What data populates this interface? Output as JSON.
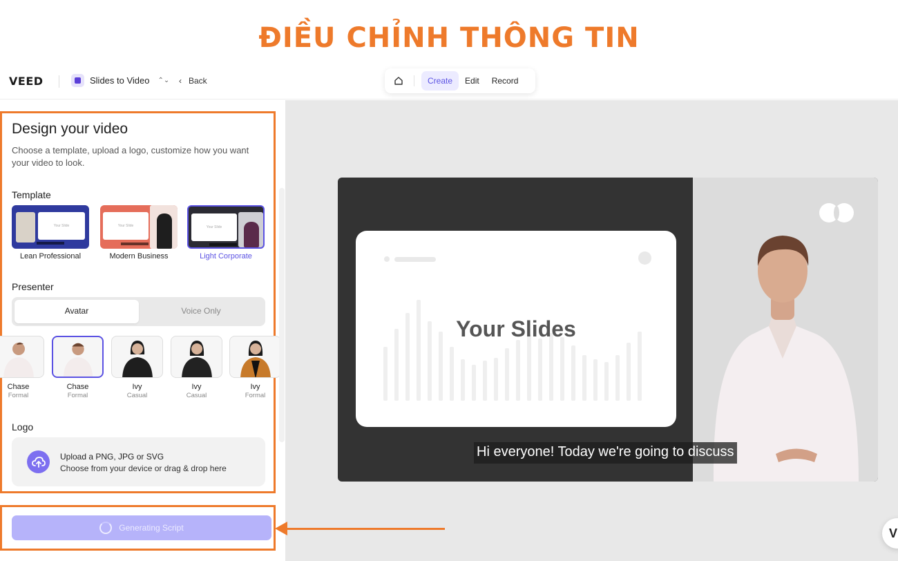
{
  "banner": {
    "title": "ĐIỀU CHỈNH THÔNG TIN"
  },
  "header": {
    "logo": "VEED",
    "project_name": "Slides to Video",
    "back_label": "Back",
    "modes": [
      "Create",
      "Edit",
      "Record"
    ],
    "active_mode": "Create"
  },
  "panel": {
    "title": "Design your video",
    "description": "Choose a template, upload a logo, customize how you want your video to look.",
    "template_label": "Template",
    "templates": [
      {
        "name": "Lean Professional",
        "slide_text": "Your Slide",
        "color": "#2f3a9e"
      },
      {
        "name": "Modern Business",
        "slide_text": "Your Slide",
        "color": "#e56d5a"
      },
      {
        "name": "Light Corporate",
        "slide_text": "Your Slide",
        "color": "#2b2b33",
        "selected": true
      }
    ],
    "presenter_label": "Presenter",
    "presenter_modes": [
      "Avatar",
      "Voice Only"
    ],
    "presenters": [
      {
        "name": "Chase",
        "style": "Formal"
      },
      {
        "name": "Chase",
        "style": "Formal",
        "selected": true
      },
      {
        "name": "Ivy",
        "style": "Casual"
      },
      {
        "name": "Ivy",
        "style": "Casual"
      },
      {
        "name": "Ivy",
        "style": "Formal"
      }
    ],
    "logo_label": "Logo",
    "upload_title": "Upload a PNG, JPG or SVG",
    "upload_hint": "Choose from your device or drag & drop here",
    "generate_label": "Generating Script"
  },
  "preview": {
    "slide_title": "Your Slides",
    "caption": "Hi everyone! Today we're going to discuss"
  },
  "colors": {
    "accent": "#5b52e3",
    "highlight": "#ee7a2b"
  }
}
